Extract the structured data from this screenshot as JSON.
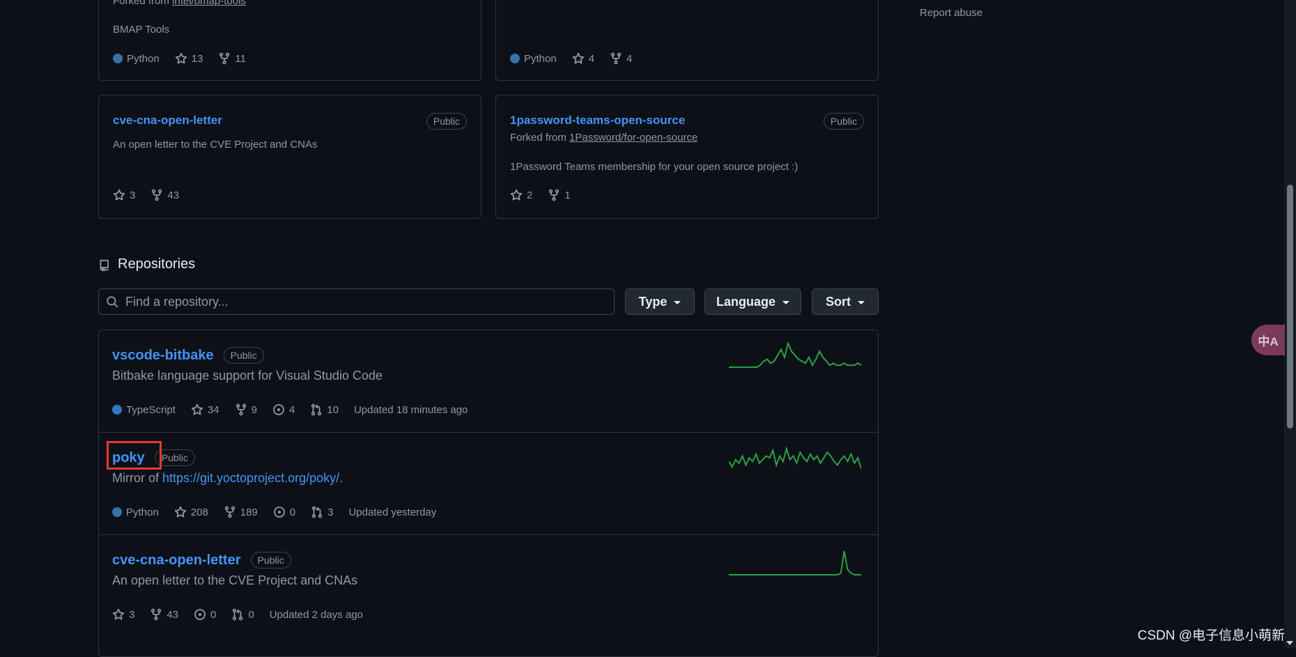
{
  "sidebar": {
    "report_abuse": "Report abuse"
  },
  "pinned_top": [
    {
      "forked_prefix": "Forked from ",
      "forked_from": "intel/bmap-tools",
      "description": "BMAP Tools",
      "language": "Python",
      "language_color": "#3572A5",
      "stars": "13",
      "forks": "11"
    },
    {
      "language": "Python",
      "language_color": "#3572A5",
      "stars": "4",
      "forks": "4"
    }
  ],
  "pinned": [
    {
      "name": "cve-cna-open-letter",
      "visibility": "Public",
      "description": "An open letter to the CVE Project and CNAs",
      "stars": "3",
      "forks": "43"
    },
    {
      "name": "1password-teams-open-source",
      "visibility": "Public",
      "forked_prefix": "Forked from ",
      "forked_from": "1Password/for-open-source",
      "description": "1Password Teams membership for your open source project :)",
      "stars": "2",
      "forks": "1"
    }
  ],
  "repositories": {
    "heading": "Repositories",
    "search_placeholder": "Find a repository...",
    "filters": {
      "type": "Type",
      "language": "Language",
      "sort": "Sort"
    },
    "items": [
      {
        "name": "vscode-bitbake",
        "visibility": "Public",
        "description": "Bitbake language support for Visual Studio Code",
        "language": "TypeScript",
        "language_color": "#3178c6",
        "stars": "34",
        "forks": "9",
        "issues": "4",
        "pulls": "10",
        "updated": "Updated 18 minutes ago",
        "activity": [
          0,
          0,
          0,
          0,
          0,
          0,
          0,
          0,
          0,
          1,
          3,
          4,
          2,
          3,
          6,
          9,
          5,
          12,
          8,
          6,
          4,
          3,
          2,
          5,
          1,
          4,
          8,
          5,
          3,
          1,
          2,
          1,
          1,
          2,
          1,
          1,
          1,
          2,
          1
        ]
      },
      {
        "name": "poky",
        "visibility": "Public",
        "description_prefix": "Mirror of ",
        "description_link": "https://git.yoctoproject.org/poky/",
        "description_suffix": ".",
        "language": "Python",
        "language_color": "#3572A5",
        "stars": "208",
        "forks": "189",
        "issues": "0",
        "pulls": "3",
        "updated": "Updated yesterday",
        "activity": [
          6,
          3,
          7,
          5,
          9,
          4,
          8,
          6,
          10,
          5,
          7,
          9,
          8,
          12,
          4,
          9,
          6,
          13,
          7,
          9,
          5,
          11,
          8,
          6,
          10,
          7,
          9,
          5,
          8,
          11,
          9,
          6,
          4,
          7,
          9,
          6,
          10,
          5,
          8,
          2
        ]
      },
      {
        "name": "cve-cna-open-letter",
        "visibility": "Public",
        "description": "An open letter to the CVE Project and CNAs",
        "stars": "3",
        "forks": "43",
        "issues": "0",
        "pulls": "0",
        "updated": "Updated 2 days ago",
        "activity": [
          0,
          0,
          0,
          0,
          0,
          0,
          0,
          0,
          0,
          0,
          0,
          0,
          0,
          0,
          0,
          0,
          0,
          0,
          0,
          0,
          0,
          0,
          0,
          0,
          0,
          0,
          0,
          0,
          0,
          0,
          0,
          0,
          0,
          1,
          14,
          3,
          1,
          0,
          0,
          0
        ]
      }
    ]
  },
  "watermark": "CSDN @电子信息小萌新",
  "translate_icon_label": "中A"
}
